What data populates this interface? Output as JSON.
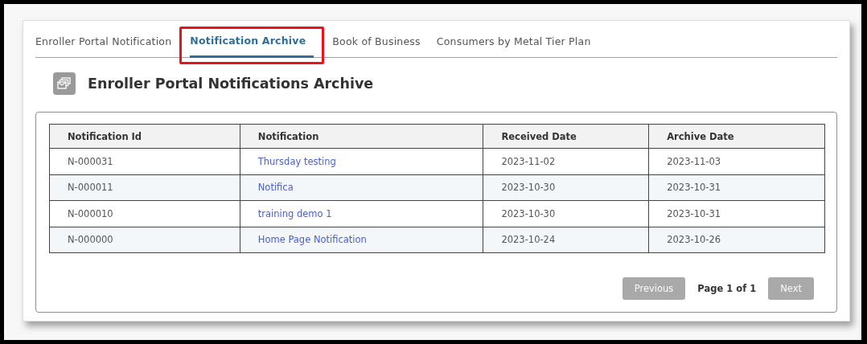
{
  "tabs": [
    {
      "label": "Enroller Portal Notification",
      "selected": false
    },
    {
      "label": "Notification Archive",
      "selected": true
    },
    {
      "label": "Book of Business",
      "selected": false
    },
    {
      "label": "Consumers by Metal Tier Plan",
      "selected": false
    }
  ],
  "title": "Enroller Portal Notifications Archive",
  "table": {
    "columns": [
      "Notification Id",
      "Notification",
      "Received Date",
      "Archive Date"
    ],
    "rows": [
      [
        "N-000031",
        "Thursday testing",
        "2023-11-02",
        "2023-11-03"
      ],
      [
        "N-000011",
        "Notifica",
        "2023-10-30",
        "2023-10-31"
      ],
      [
        "N-000010",
        "training demo 1",
        "2023-10-30",
        "2023-10-31"
      ],
      [
        "N-000000",
        "Home Page Notification",
        "2023-10-24",
        "2023-10-26"
      ]
    ]
  },
  "pagination": {
    "previous": {
      "label": "Previous",
      "disabled": true
    },
    "page": "Page 1 of 1",
    "next": {
      "label": "Next",
      "disabled": true
    }
  }
}
